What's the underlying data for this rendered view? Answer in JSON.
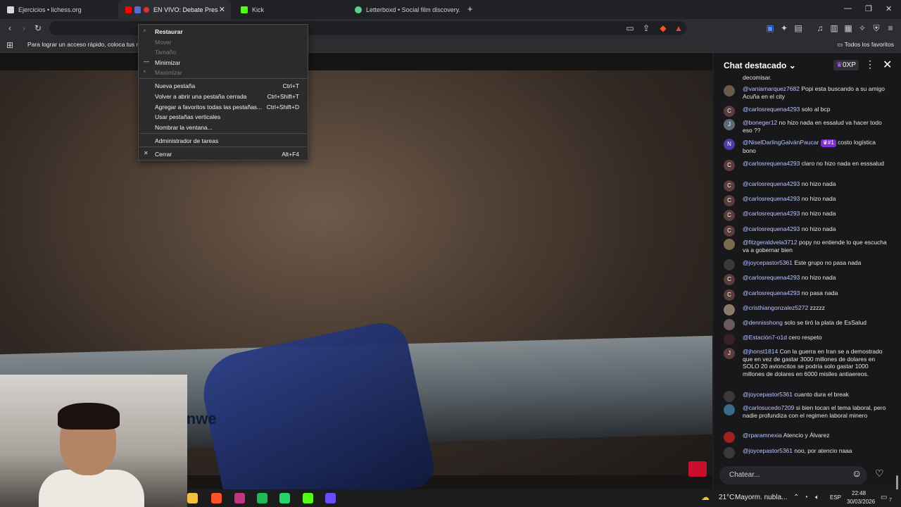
{
  "tabs": [
    {
      "title": "Ejercicios • lichess.org",
      "color": "#d9d9d9"
    },
    {
      "title": "EN VIVO: Debate Presiden",
      "color": "#ff0000",
      "active": true
    },
    {
      "title": "Kick",
      "color": "#53fc18"
    },
    {
      "title": "Letterboxd • Social film discovery.",
      "color": "#5bd18b"
    }
  ],
  "toolbar": {
    "url_fragment": "E"
  },
  "bookmarks": {
    "hint": "Para lograr un acceso rápido, coloca tus mar",
    "all_favorites": "Todos los favoritos"
  },
  "context_menu": {
    "items": [
      {
        "label": "Restaurar",
        "icon": "restore-icon",
        "enabled": true,
        "bold": true,
        "shortcut": ""
      },
      {
        "label": "Mover",
        "icon": "",
        "enabled": false,
        "shortcut": ""
      },
      {
        "label": "Tamaño",
        "icon": "",
        "enabled": false,
        "shortcut": ""
      },
      {
        "label": "Minimizar",
        "icon": "minimize-icon",
        "enabled": true,
        "shortcut": ""
      },
      {
        "label": "Maximizar",
        "icon": "maximize-icon",
        "enabled": false,
        "shortcut": ""
      },
      {
        "label": "Nueva pestaña",
        "enabled": true,
        "shortcut": "Ctrl+T"
      },
      {
        "label": "Volver a abrir una pestaña cerrada",
        "enabled": true,
        "shortcut": "Ctrl+Shift+T"
      },
      {
        "label": "Agregar a favoritos todas las pestañas...",
        "enabled": true,
        "shortcut": "Ctrl+Shift+D"
      },
      {
        "label": "Usar pestañas verticales",
        "enabled": true,
        "shortcut": ""
      },
      {
        "label": "Nombrar la ventana...",
        "enabled": true,
        "shortcut": ""
      },
      {
        "label": "Administrador de tareas",
        "enabled": true,
        "shortcut": ""
      },
      {
        "label": "Cerrar",
        "icon": "close-icon",
        "enabled": true,
        "shortcut": "Alt+F4"
      }
    ]
  },
  "video": {
    "brand_text": "Feinwe"
  },
  "chat": {
    "title": "Chat destacado",
    "xp": "0XP",
    "top_fragment": "decomisar.",
    "input_placeholder": "Chatear...",
    "messages": [
      {
        "user": "@vaniamarquez7682",
        "text": "Popi esta buscando a su amigo Acuña en el city",
        "avatar": "",
        "avatar_color": "#6b5a4a"
      },
      {
        "user": "@carlosrequena4293",
        "text": "solo al bcp",
        "avatar": "C",
        "avatar_color": "#5a3c3c"
      },
      {
        "user": "@boneger12",
        "text": "no hizo nada en essalud va hacer todo eso ??",
        "avatar": "J",
        "avatar_color": "#5c6a78"
      },
      {
        "user": "@NiselDarlingGalvánPaucar",
        "badge": "#1",
        "text": "costo logística bono",
        "avatar": "N",
        "avatar_color": "#4a3da8"
      },
      {
        "user": "@carlosrequena4293",
        "text": "claro no hizo nada en esssalud",
        "avatar": "C",
        "avatar_color": "#5a3c3c"
      },
      {
        "user": "@carlosrequena4293",
        "text": "no hizo nada",
        "avatar": "C",
        "avatar_color": "#5a3c3c"
      },
      {
        "user": "@carlosrequena4293",
        "text": "no hizo nada",
        "avatar": "C",
        "avatar_color": "#5a3c3c"
      },
      {
        "user": "@carlosrequena4293",
        "text": "no hizo nada",
        "avatar": "C",
        "avatar_color": "#5a3c3c"
      },
      {
        "user": "@carlosrequena4293",
        "text": "no hizo nada",
        "avatar": "C",
        "avatar_color": "#5a3c3c"
      },
      {
        "user": "@fitzgeraldvela3712",
        "text": "popy no entiende lo que escucha va a gobernar bien",
        "avatar": "",
        "avatar_color": "#7a6a50"
      },
      {
        "user": "@joycepastor5361",
        "text": "Este grupo no pasa nada",
        "avatar": "",
        "avatar_color": "#3a3a3a"
      },
      {
        "user": "@carlosrequena4293",
        "text": "no hizo nada",
        "avatar": "C",
        "avatar_color": "#5a3c3c"
      },
      {
        "user": "@carlosrequena4293",
        "text": "no pasa nada",
        "avatar": "C",
        "avatar_color": "#5a3c3c"
      },
      {
        "user": "@cristhiangonzalez5272",
        "text": "zzzzz",
        "avatar": "",
        "avatar_color": "#8a7a6a"
      },
      {
        "user": "@dennisshong",
        "text": "solo se tiró la plata de EsSalud",
        "avatar": "",
        "avatar_color": "#6a5a5a"
      },
      {
        "user": "@Estación7-o1d",
        "text": "cero respeto",
        "avatar": "",
        "avatar_color": "#3a2020"
      },
      {
        "user": "@jhonst1814",
        "text": "Con la guerra en Iran se a demostrado que en vez de gastar 3000 millones de dolares en SOLO 20 avioncitos se podría solo gastar 1000 millones de dolares en 6000 misiles antiaereos.",
        "avatar": "J",
        "avatar_color": "#5a3c3c"
      },
      {
        "user": "@joycepastor5361",
        "text": "cuanto dura el break",
        "avatar": "",
        "avatar_color": "#3a3a3a"
      },
      {
        "user": "@carlosucedo7209",
        "text": "si bien tocan el tema laboral, pero nadie profundiza con el regimen laboral minero",
        "avatar": "",
        "avatar_color": "#3a6a8a"
      },
      {
        "user": "@rparamnexia",
        "text": "Atencio y Álvarez",
        "avatar": "",
        "avatar_color": "#a02020"
      },
      {
        "user": "@joycepastor5361",
        "text": "noo, por atencio naaa",
        "avatar": "",
        "avatar_color": "#3a3a3a"
      }
    ]
  },
  "taskbar": {
    "apps": [
      {
        "name": "file-explorer-icon",
        "color": "#f0c040"
      },
      {
        "name": "brave-icon",
        "color": "#fb542b"
      },
      {
        "name": "instagram-icon",
        "color": "#c13584"
      },
      {
        "name": "spotify-icon",
        "color": "#1db954"
      },
      {
        "name": "whatsapp-icon",
        "color": "#25d366"
      },
      {
        "name": "kick-icon",
        "color": "#53fc18"
      },
      {
        "name": "app-icon",
        "color": "#6a4cff"
      }
    ],
    "weather_temp": "21°C",
    "weather_desc": "Mayorm. nubla...",
    "lang": "ESP",
    "time": "22:48",
    "date": "30/03/2026",
    "notifications": "7"
  }
}
